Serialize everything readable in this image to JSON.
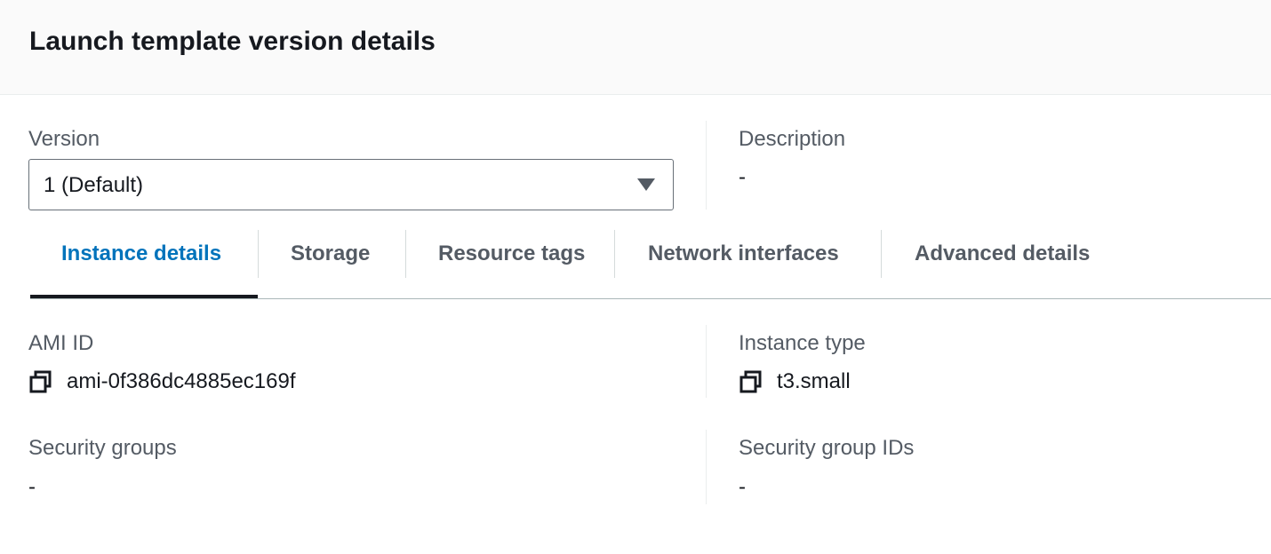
{
  "header": {
    "title": "Launch template version details"
  },
  "version": {
    "label": "Version",
    "selected": "1 (Default)"
  },
  "description": {
    "label": "Description",
    "value": "-"
  },
  "tabs": [
    {
      "label": "Instance details",
      "active": true
    },
    {
      "label": "Storage"
    },
    {
      "label": "Resource tags"
    },
    {
      "label": "Network interfaces"
    },
    {
      "label": "Advanced details"
    }
  ],
  "details": {
    "ami_id": {
      "label": "AMI ID",
      "value": "ami-0f386dc4885ec169f"
    },
    "instance_type": {
      "label": "Instance type",
      "value": "t3.small"
    },
    "security_groups": {
      "label": "Security groups",
      "value": "-"
    },
    "security_group_ids": {
      "label": "Security group IDs",
      "value": "-"
    }
  },
  "icons": {
    "copy": "copy-icon",
    "dropdown": "caret-down-icon"
  },
  "colors": {
    "active_tab": "#0073bb",
    "text": "#16191f",
    "muted": "#545b64"
  }
}
